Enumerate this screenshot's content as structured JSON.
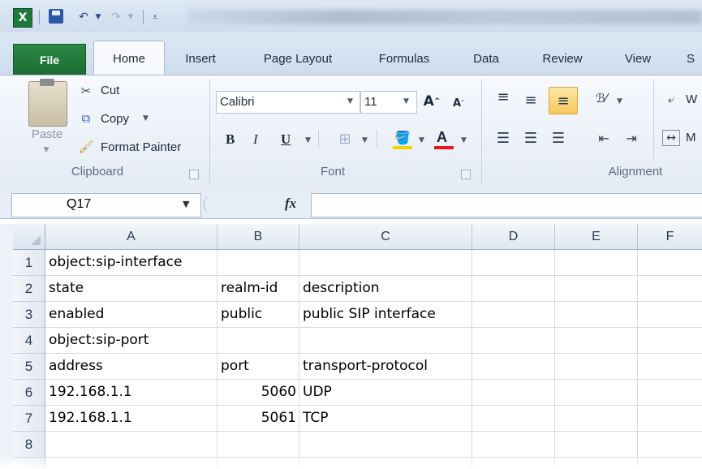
{
  "quick_access": {
    "logo": "X"
  },
  "tabs": [
    "File",
    "Home",
    "Insert",
    "Page Layout",
    "Formulas",
    "Data",
    "Review",
    "View",
    "S"
  ],
  "clipboard": {
    "paste": "Paste",
    "cut": "Cut",
    "copy": "Copy",
    "format_painter": "Format Painter",
    "group": "Clipboard"
  },
  "font": {
    "name": "Calibri",
    "size": "11",
    "bold": "B",
    "italic": "I",
    "underline": "U",
    "font_color": "A",
    "group": "Font"
  },
  "alignment": {
    "wrap": "W",
    "merge": "M",
    "group": "Alignment"
  },
  "formula_bar": {
    "name_box": "Q17",
    "fx": "fx",
    "formula": ""
  },
  "columns": [
    "A",
    "B",
    "C",
    "D",
    "E",
    "F"
  ],
  "rows": [
    {
      "n": "1",
      "a": "object:sip-interface",
      "b": "",
      "c": ""
    },
    {
      "n": "2",
      "a": "state",
      "b": "realm-id",
      "c": "description"
    },
    {
      "n": "3",
      "a": "enabled",
      "b": "public",
      "c": "public SIP interface"
    },
    {
      "n": "4",
      "a": "object:sip-port",
      "b": "",
      "c": ""
    },
    {
      "n": "5",
      "a": "address",
      "b": "port",
      "c": "transport-protocol"
    },
    {
      "n": "6",
      "a": "192.168.1.1",
      "b": "5060",
      "c": "UDP"
    },
    {
      "n": "7",
      "a": "192.168.1.1",
      "b": "5061",
      "c": "TCP"
    },
    {
      "n": "8",
      "a": "",
      "b": "",
      "c": ""
    }
  ],
  "colors": {
    "file_tab": "#1b6b32",
    "ribbon_bg": "#eef3f9",
    "highlight": "#f7c65e"
  }
}
